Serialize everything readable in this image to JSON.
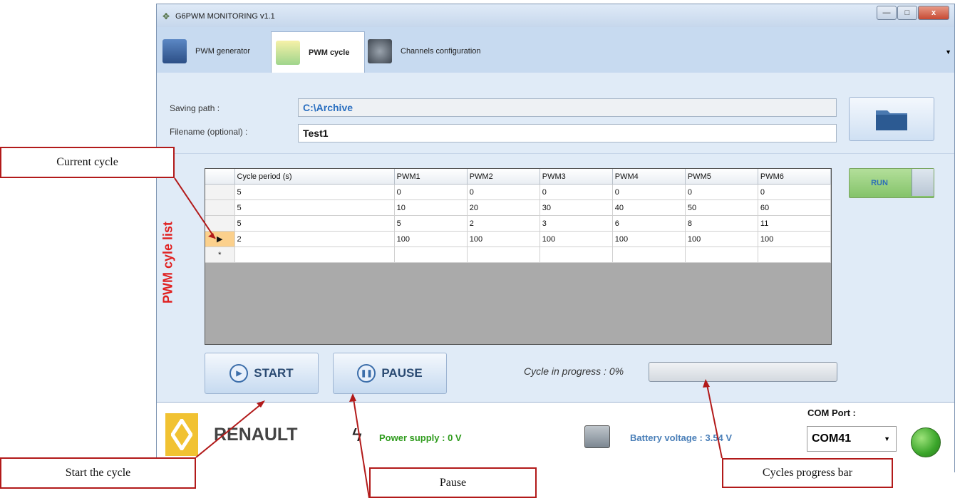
{
  "window": {
    "title": "G6PWM MONITORING v1.1",
    "controls": {
      "minimize": "—",
      "maximize": "□",
      "close": "x"
    }
  },
  "tabs": [
    {
      "label": "PWM generator",
      "icon": "pwm-generator-icon"
    },
    {
      "label": "PWM cycle",
      "icon": "pwm-cycle-icon",
      "active": true
    },
    {
      "label": "Channels configuration",
      "icon": "gear-icon"
    }
  ],
  "tab_overflow": "▼",
  "saving": {
    "path_label": "Saving path :",
    "path_value": "C:\\Archive",
    "filename_label": "Filename (optional) :",
    "filename_value": "Test1",
    "browse_icon": "folder-icon"
  },
  "list_title": "PWM cyle list",
  "grid": {
    "columns": [
      "Cycle period (s)",
      "PWM1",
      "PWM2",
      "PWM3",
      "PWM4",
      "PWM5",
      "PWM6"
    ],
    "rows": [
      [
        "5",
        "0",
        "0",
        "0",
        "0",
        "0",
        "0"
      ],
      [
        "5",
        "10",
        "20",
        "30",
        "40",
        "50",
        "60"
      ],
      [
        "5",
        "5",
        "2",
        "3",
        "6",
        "8",
        "11"
      ],
      [
        "2",
        "100",
        "100",
        "100",
        "100",
        "100",
        "100"
      ]
    ],
    "current_row_index": 3,
    "current_marker": "▶",
    "new_row_marker": "*"
  },
  "run_label": "RUN",
  "start_label": "START",
  "pause_label": "PAUSE",
  "progress": {
    "label": "Cycle in progress : 0%",
    "value": 0
  },
  "footer": {
    "brand": "RENAULT",
    "power_supply": "Power supply : 0 V",
    "battery_voltage": "Battery voltage : 3.54 V",
    "com_port_label": "COM Port :",
    "com_port_value": "COM41",
    "status_led_color": "#3aa52a"
  },
  "callouts": {
    "current_cycle": "Current cycle",
    "start": "Start the cycle",
    "pause": "Pause",
    "progress": "Cycles progress bar"
  },
  "colors": {
    "callout_border": "#b21a1a",
    "list_title": "#e02020",
    "power": "#2e9b1c",
    "battery": "#4a7fb8"
  }
}
